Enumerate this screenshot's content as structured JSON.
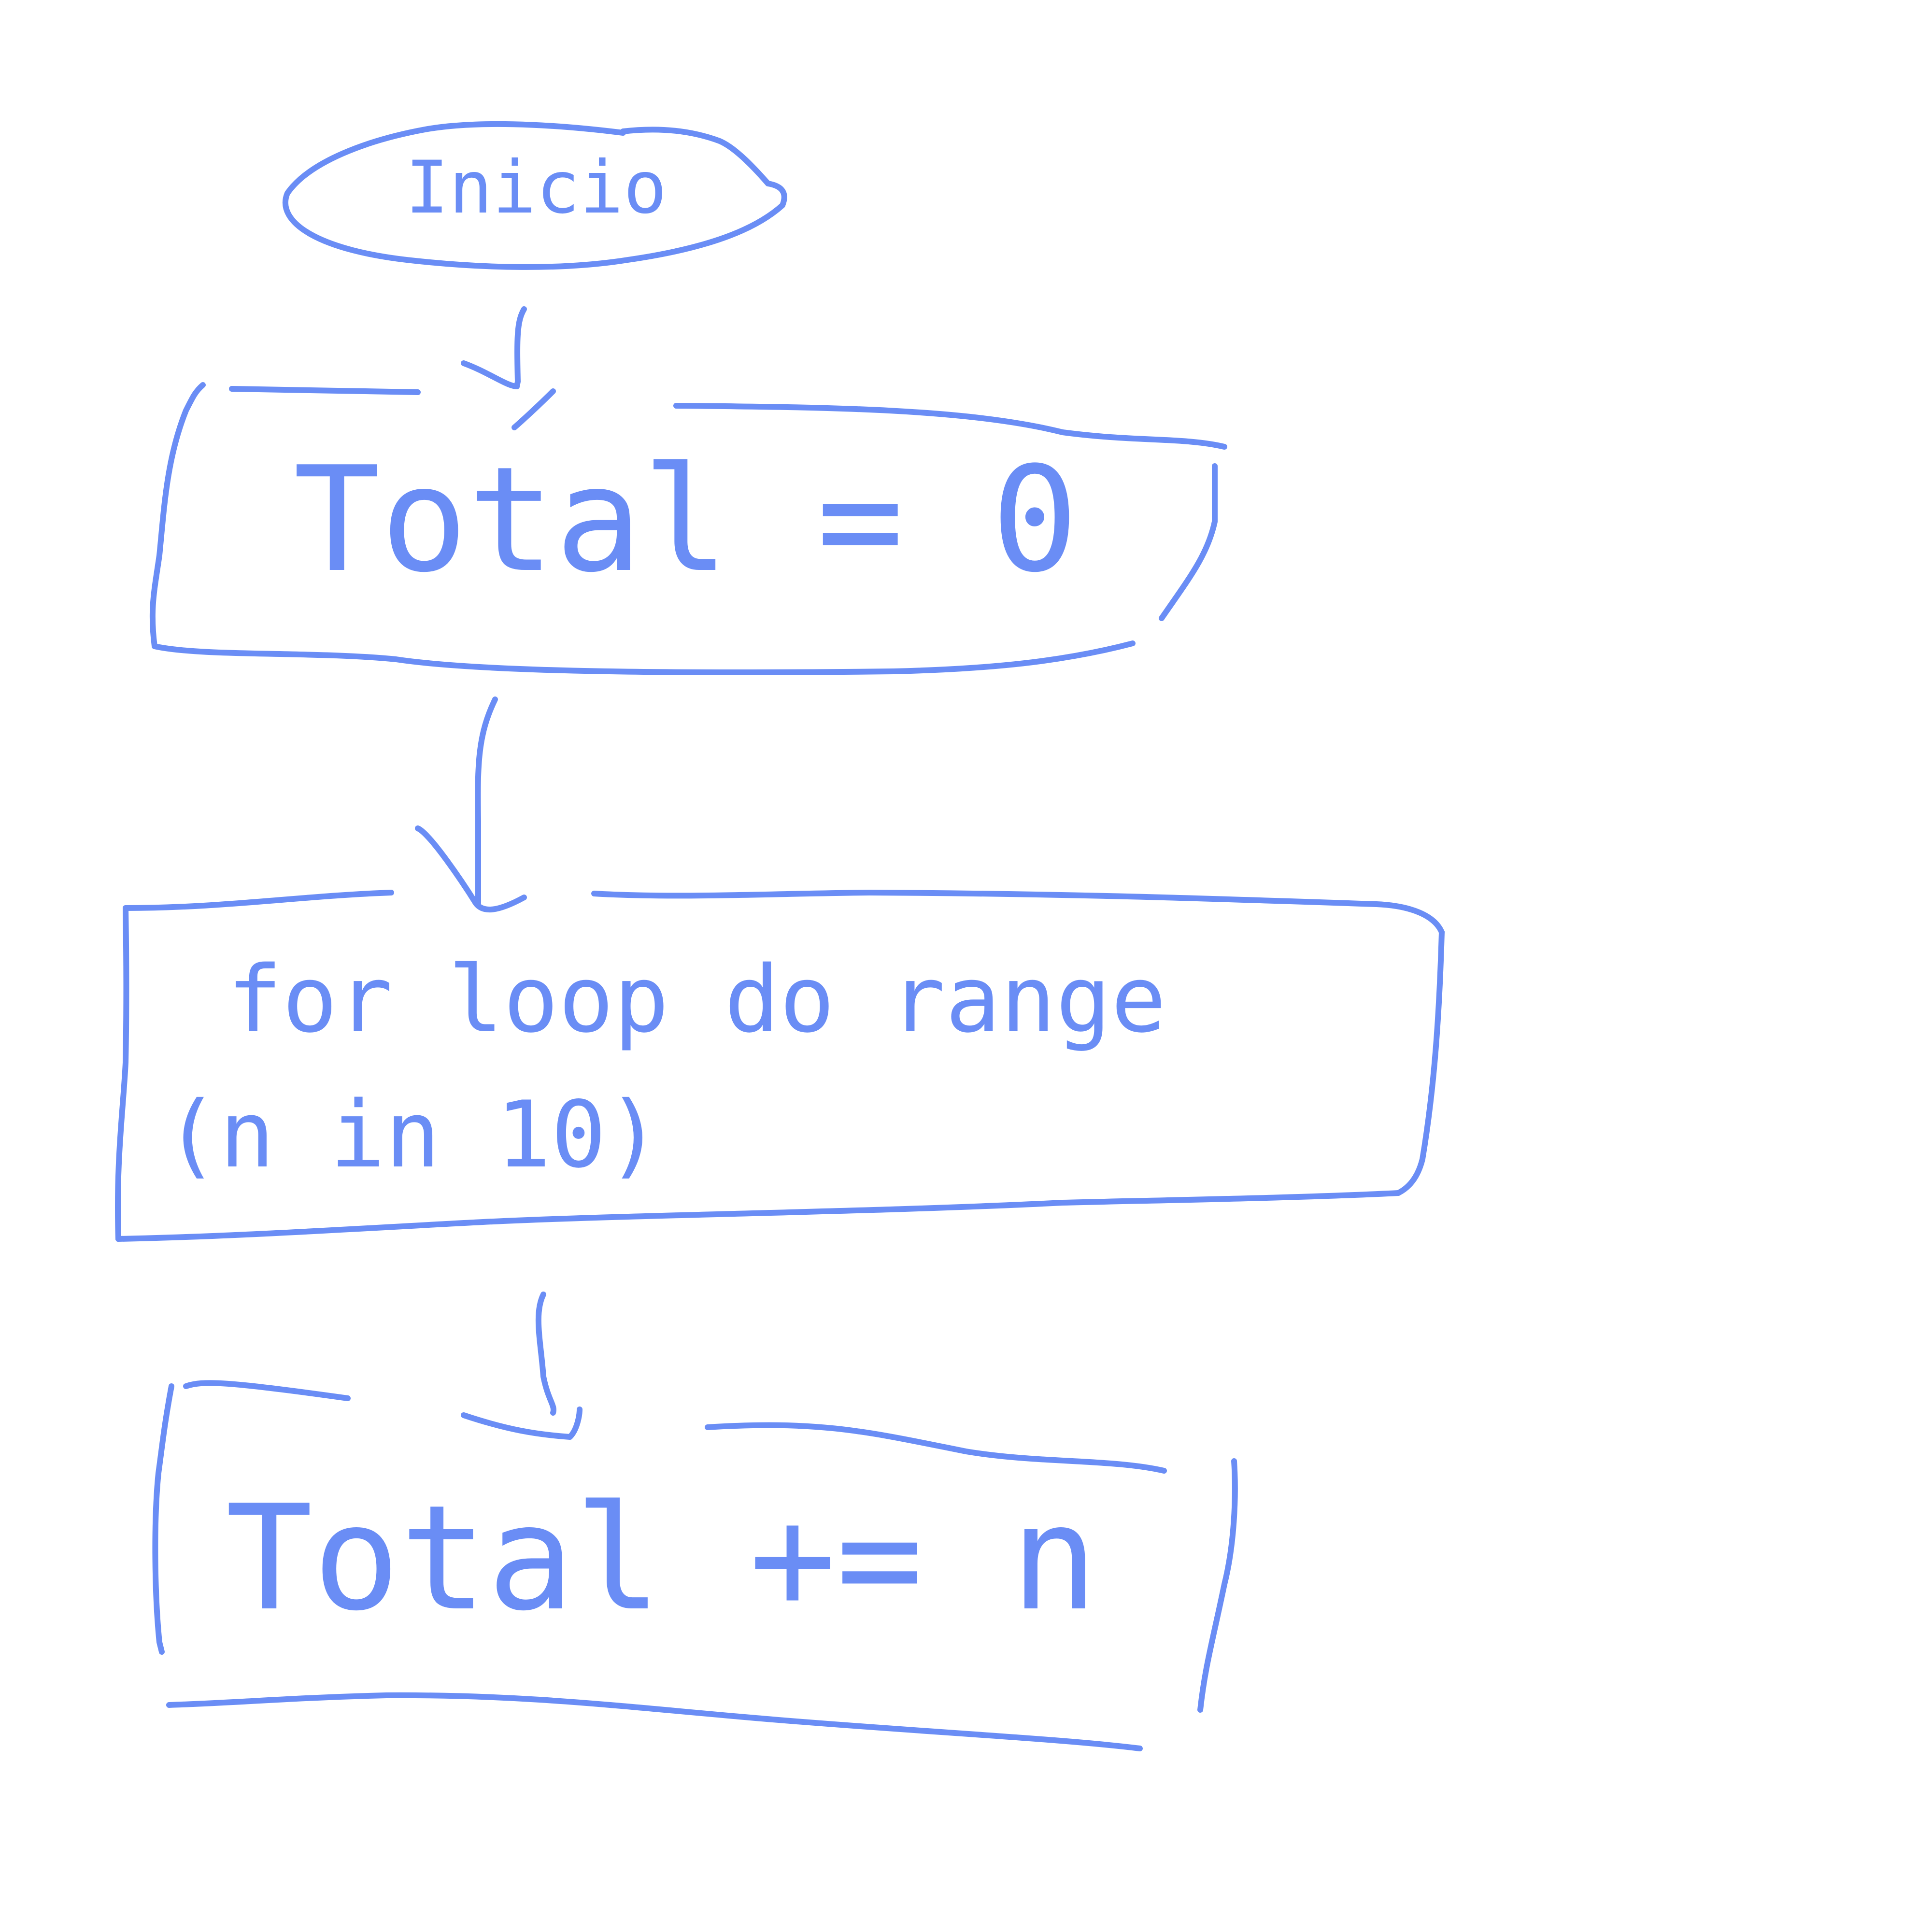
{
  "ink_color": "#6a8df5",
  "shapes": {
    "start": {
      "label": "Inicio"
    },
    "init": {
      "label": "Total = 0"
    },
    "loop": {
      "line1": "for loop do range",
      "line2": "(n in 10)"
    },
    "accumulate": {
      "label": "Total += n"
    }
  }
}
